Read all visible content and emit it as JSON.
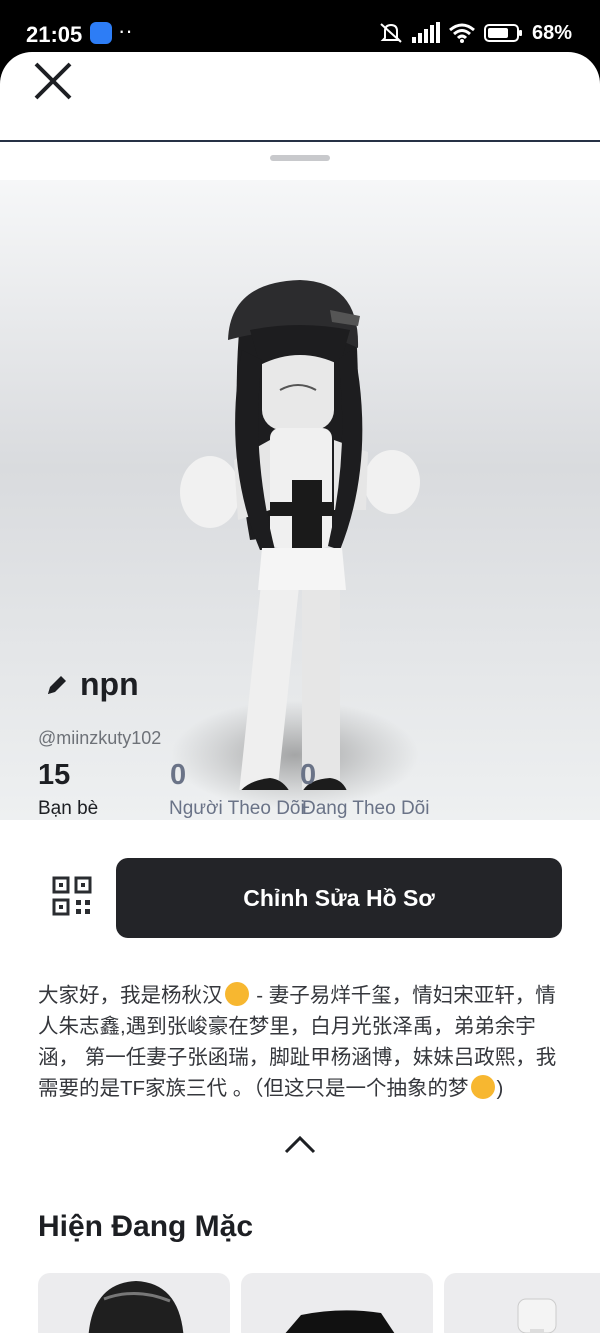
{
  "status_bar": {
    "time": "21:05",
    "battery": "68%"
  },
  "profile": {
    "display_name": "npn",
    "username": "@miinzkuty102",
    "stats": [
      {
        "value": "15",
        "label": "Bạn bè"
      },
      {
        "value": "0",
        "label": "Người Theo Dõi"
      },
      {
        "value": "0",
        "label": "Đang Theo Dõi"
      }
    ],
    "edit_button": "Chỉnh Sửa Hồ Sơ",
    "bio": [
      "大家好，我是杨秋汉",
      " - 妻子易烊千玺，情妇宋亚轩，情人朱志鑫,遇到张峻豪在梦里，白月光张泽禹，弟弟余宇涵， 第一任妻子张函瑞，脚趾甲杨涵博，妹妹吕政熙，我需要的是TF家族三代 。（但这只是一个抽象的梦",
      ")"
    ]
  },
  "wearing": {
    "title": "Hiện Đang Mặc"
  },
  "colors": {
    "button_bg": "#232428",
    "accent_stat": "#1d1f23",
    "muted_stat": "#6a7387"
  }
}
